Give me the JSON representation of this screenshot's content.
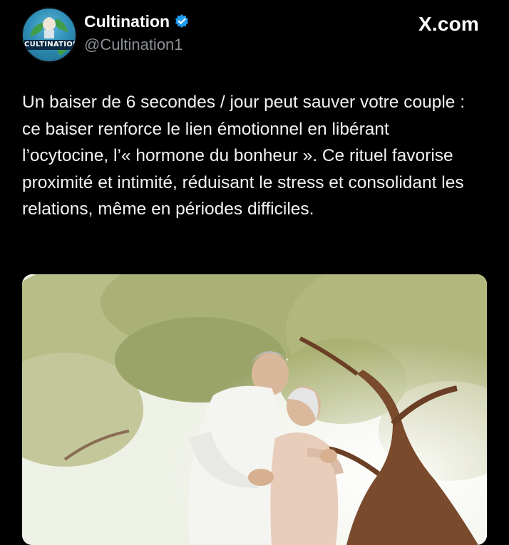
{
  "header": {
    "avatar_label": "CULTINATION",
    "display_name": "Cultination",
    "handle": "@Cultination1",
    "site_label": "X.com",
    "verified_icon": "verified-badge-icon"
  },
  "tweet": {
    "text": "Un baiser de 6 secondes / jour peut sauver votre couple : ce baiser renforce le lien émotionnel en libérant l’ocytocine, l’« hormone du bonheur ». Ce rituel favorise proximité et intimité, réduisant le stress et consolidant les relations, même en périodes difficiles."
  },
  "colors": {
    "background": "#000000",
    "text": "#f2f2f2",
    "handle": "#8b8f94",
    "verified": "#1d9bf0"
  }
}
